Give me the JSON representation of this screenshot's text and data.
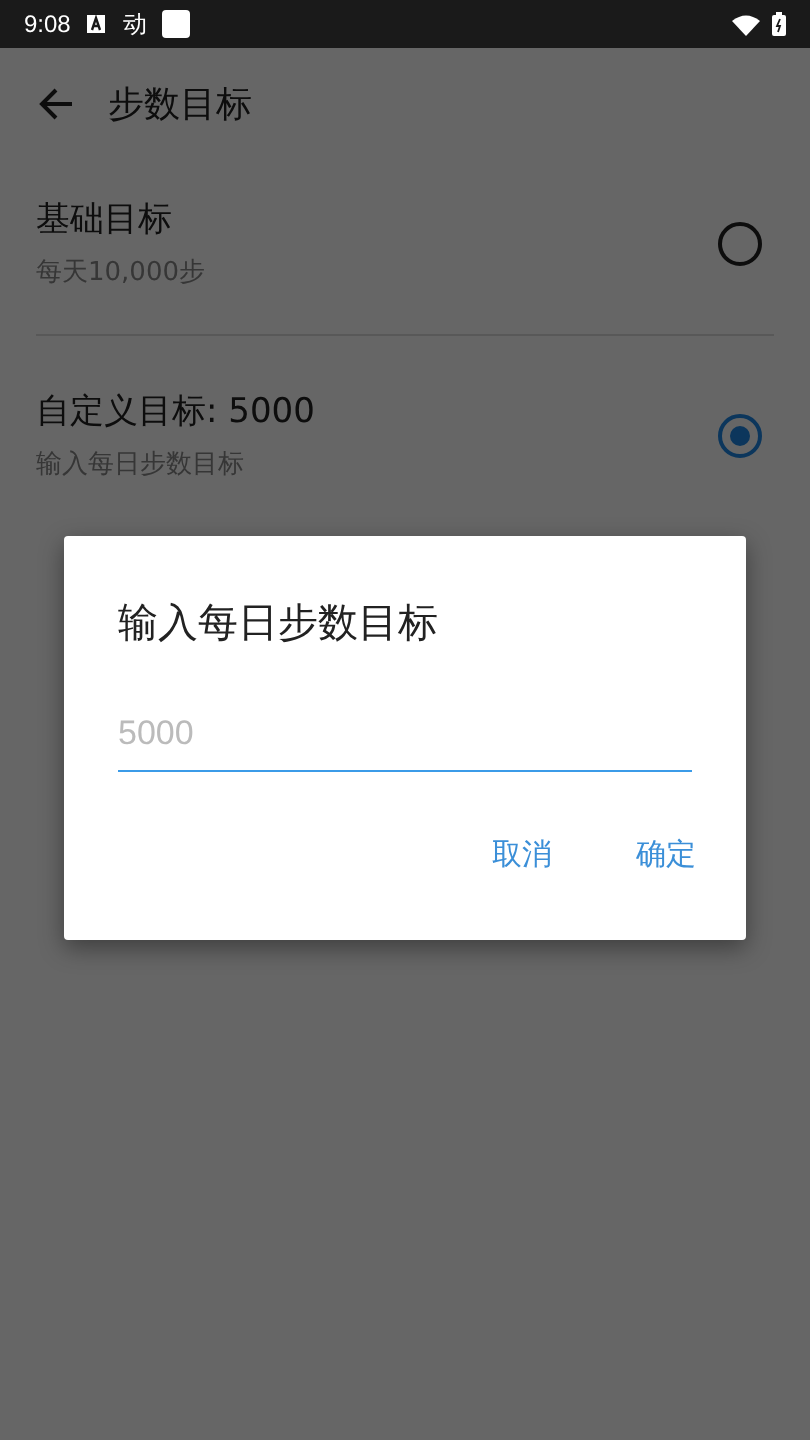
{
  "status_bar": {
    "time": "9:08",
    "notification_text": "动"
  },
  "toolbar": {
    "title": "步数目标"
  },
  "options": [
    {
      "title": "基础目标",
      "subtitle": "每天10,000步",
      "selected": false
    },
    {
      "title": "自定义目标: 5000",
      "subtitle": "输入每日步数目标",
      "selected": true
    }
  ],
  "dialog": {
    "title": "输入每日步数目标",
    "field": {
      "placeholder": "5000"
    },
    "buttons": [
      "取消",
      "确定"
    ]
  }
}
